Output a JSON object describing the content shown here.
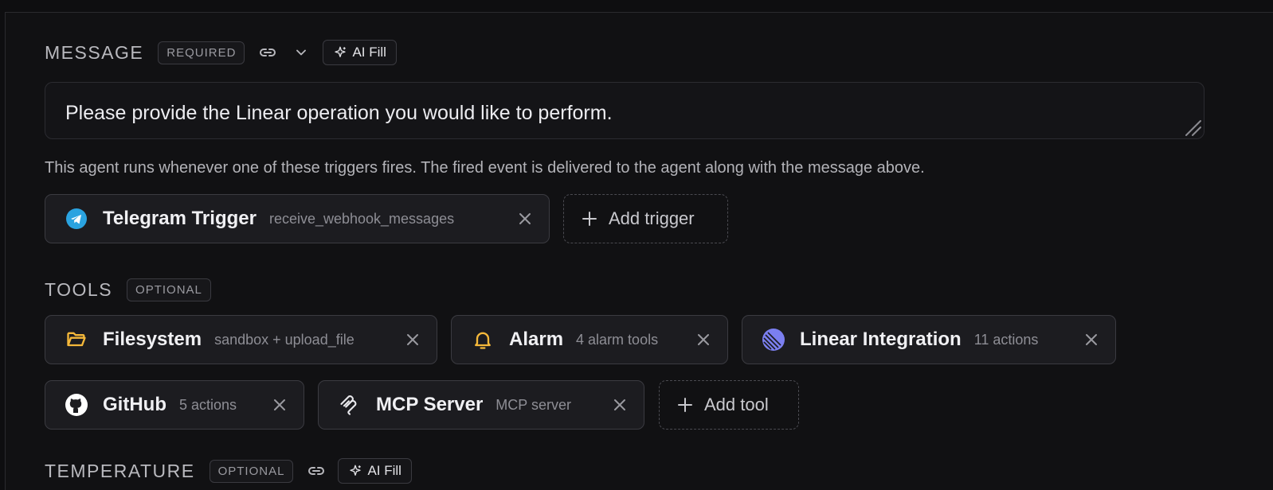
{
  "message": {
    "title": "MESSAGE",
    "badge": "REQUIRED",
    "ai_fill_label": "AI Fill",
    "value": "Please provide the Linear operation you would like to perform.",
    "help": "This agent runs whenever one of these triggers fires. The fired event is delivered to the agent along with the message above."
  },
  "triggers": {
    "items": [
      {
        "name": "Telegram Trigger",
        "meta": "receive_webhook_messages",
        "icon": "telegram-icon"
      }
    ],
    "add_label": "Add trigger"
  },
  "tools": {
    "title": "TOOLS",
    "badge": "OPTIONAL",
    "items": [
      {
        "name": "Filesystem",
        "meta": "sandbox + upload_file",
        "icon": "folder-icon"
      },
      {
        "name": "Alarm",
        "meta": "4 alarm tools",
        "icon": "bell-icon"
      },
      {
        "name": "Linear Integration",
        "meta": "11 actions",
        "icon": "linear-icon"
      },
      {
        "name": "GitHub",
        "meta": "5 actions",
        "icon": "github-icon"
      },
      {
        "name": "MCP Server",
        "meta": "MCP server",
        "icon": "mcp-icon"
      }
    ],
    "add_label": "Add tool"
  },
  "temperature": {
    "title": "TEMPERATURE",
    "badge": "OPTIONAL",
    "ai_fill_label": "AI Fill"
  },
  "colors": {
    "background": "#111113",
    "chip": "#1c1c20",
    "telegram": "#2aa3e0",
    "folder": "#f5b83a",
    "bell": "#f5b83a",
    "linear": "#7b7ff0"
  }
}
